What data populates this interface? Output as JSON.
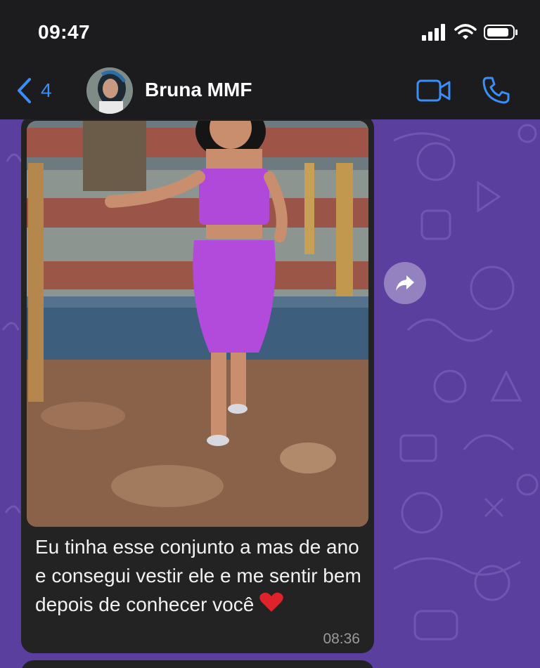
{
  "status_bar": {
    "time": "09:47"
  },
  "nav": {
    "back_count": "4",
    "contact_name": "Bruna MMF"
  },
  "message": {
    "text": "Eu tinha esse conjunto a mas de ano e consegui vestir ele e me sentir bem depois de conhecer você",
    "emoji": "heart",
    "time": "08:36"
  },
  "colors": {
    "accent": "#3a8ef6",
    "wallpaper": "#5b3f9e",
    "bubble": "#232323"
  }
}
